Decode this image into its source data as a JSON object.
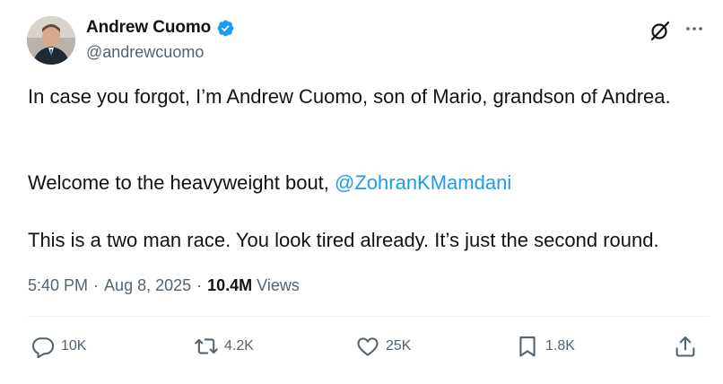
{
  "author": {
    "display_name": "Andrew Cuomo",
    "handle": "@andrewcuomo",
    "verified": true
  },
  "tweet": {
    "line1": "In case you forgot, I’m Andrew Cuomo, son of Mario, grandson of Andrea.",
    "line2_prefix": "Welcome to the heavyweight bout, ",
    "mention": "@ZohranKMamdani",
    "line3": "This is a two man race. You look tired already. It’s just the second round."
  },
  "meta": {
    "time": "5:40 PM",
    "separator": "·",
    "date": "Aug 8, 2025",
    "views_count": "10.4M",
    "views_label": "Views"
  },
  "actions": {
    "replies": "10K",
    "reposts": "4.2K",
    "likes": "25K",
    "bookmarks": "1.8K"
  },
  "colors": {
    "accent": "#1d9bf0",
    "text": "#0f1419",
    "secondary": "#536471"
  },
  "icons": [
    "verified-badge-icon",
    "grok-icon",
    "more-icon",
    "reply-icon",
    "repost-icon",
    "like-icon",
    "bookmark-icon",
    "share-icon"
  ]
}
